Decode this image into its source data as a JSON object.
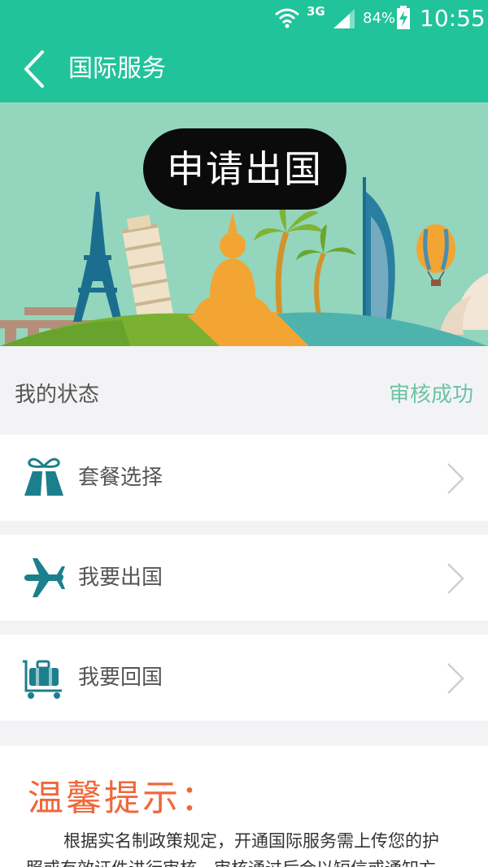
{
  "status_bar": {
    "network": "3G",
    "battery": "84%",
    "time": "10:55"
  },
  "app_bar": {
    "title": "国际服务"
  },
  "banner": {
    "button_label": "申请出国"
  },
  "status": {
    "label": "我的状态",
    "value": "审核成功"
  },
  "menu": [
    {
      "label": "套餐选择",
      "icon": "gift-icon"
    },
    {
      "label": "我要出国",
      "icon": "airplane-icon"
    },
    {
      "label": "我要回国",
      "icon": "luggage-cart-icon"
    }
  ],
  "tip": {
    "title": "温馨提示：",
    "text": "根据实名制政策规定，开通国际服务需上传您的护照或有效证件进行审核，审核通过后会以短信或通知方式告知您。"
  },
  "colors": {
    "primary": "#21c39a",
    "status_value": "#6cc3a6",
    "tip_title": "#f0673a",
    "icon": "#1c7f8c"
  }
}
